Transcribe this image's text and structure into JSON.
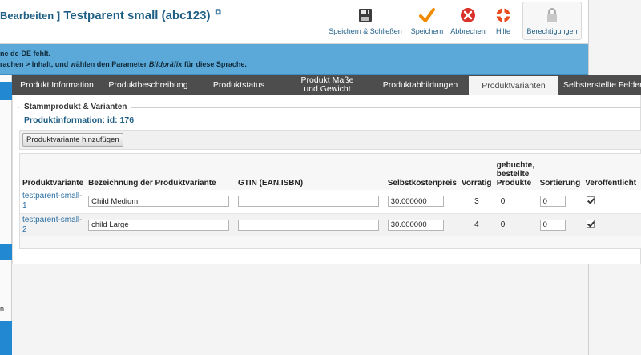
{
  "header": {
    "context_label": "Bearbeiten ]",
    "title": "Testparent small (abc123)"
  },
  "toolbar": {
    "save_close": "Speichern & Schließen",
    "save": "Speichern",
    "cancel": "Abbrechen",
    "help": "Hilfe",
    "permissions": "Berechtigungen"
  },
  "message": {
    "line1": "ne de-DE fehlt.",
    "line2_a": "rachen > Inhalt, und wählen den Parameter ",
    "line2_param": "Bildpräfix",
    "line2_b": " für diese Sprache."
  },
  "sidebar": {
    "partial_text": "n"
  },
  "tabs": [
    "Produkt Information",
    "Produktbeschreibung",
    "Produktstatus",
    "Produkt Maße und Gewicht",
    "Produktabbildungen",
    "Produktvarianten",
    "Selbsterstellte Felder"
  ],
  "active_tab": "Produktvarianten",
  "section": {
    "legend": "Stammprodukt & Varianten",
    "product_info": "Produktinformation: id: 176",
    "add_button": "Produktvariante hinzufügen"
  },
  "table": {
    "headers": {
      "variant": "Produktvariante",
      "name": "Bezeichnung der Produktvariante",
      "gtin": "GTIN (EAN,ISBN)",
      "cost": "Selbstkostenpreis",
      "stock": "Vorrätig",
      "booked": "gebuchte, bestellte Produkte",
      "sort": "Sortierung",
      "published": "Veröffentlicht"
    },
    "rows": [
      {
        "variant": "testparent-small-1",
        "name": "Child Medium",
        "gtin": "",
        "cost": "30.000000",
        "stock": "3",
        "booked": "0",
        "sort": "0",
        "published": true
      },
      {
        "variant": "testparent-small-2",
        "name": "child Large",
        "gtin": "",
        "cost": "30.000000",
        "stock": "4",
        "booked": "0",
        "sort": "0",
        "published": true
      }
    ]
  },
  "colors": {
    "brand": "#1f5f86",
    "message_bg": "#5ba9d8",
    "tab_bar": "#4d4d4d",
    "sidebar_accent": "#2288d2"
  }
}
